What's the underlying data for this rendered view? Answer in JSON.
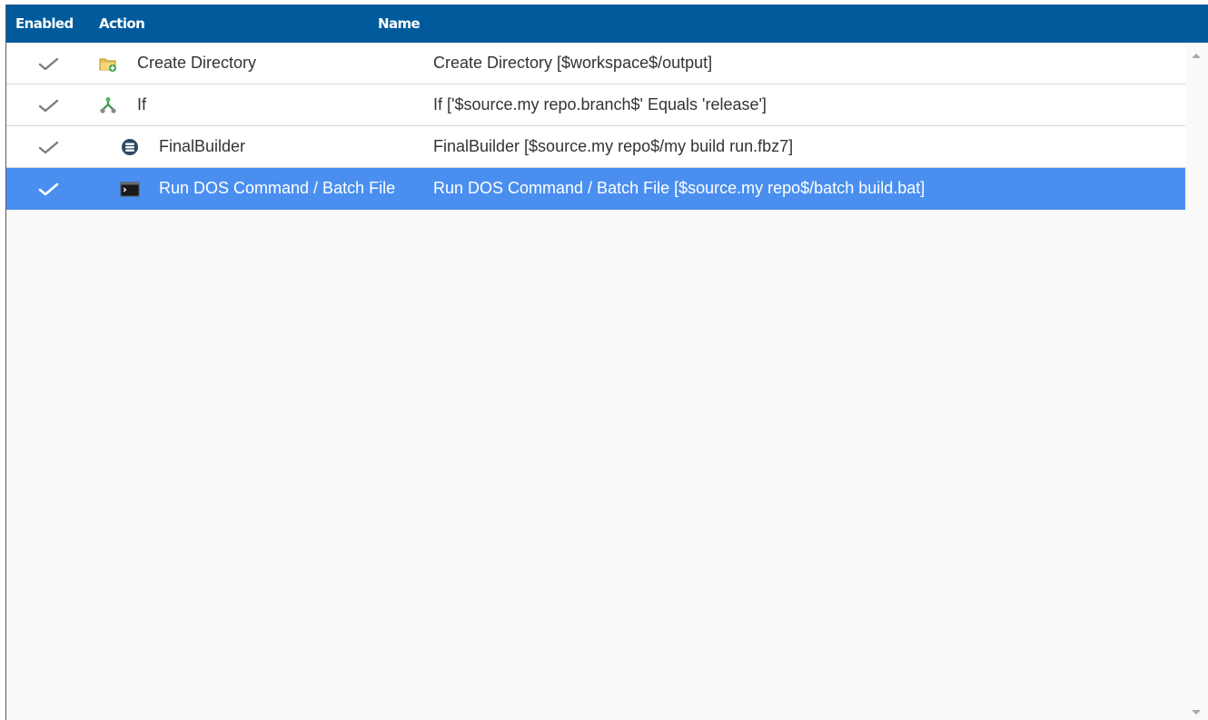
{
  "grid": {
    "columns": {
      "enabled": "Enabled",
      "action": "Action",
      "name": "Name"
    },
    "rows": [
      {
        "enabled": true,
        "icon": "folder-add-icon",
        "action": "Create Directory",
        "name": "Create Directory [$workspace$/output]",
        "selected": false
      },
      {
        "enabled": true,
        "icon": "branch-icon",
        "action": "If",
        "name": "If ['$source.my repo.branch$' Equals 'release']",
        "selected": false
      },
      {
        "enabled": true,
        "icon": "finalbuilder-icon",
        "action": "FinalBuilder",
        "name": "FinalBuilder [$source.my repo$/my build run.fbz7]",
        "selected": false
      },
      {
        "enabled": true,
        "icon": "console-icon",
        "action": "Run DOS Command / Batch File",
        "name": "Run DOS Command / Batch File [$source.my repo$/batch build.bat]",
        "selected": true
      }
    ]
  },
  "colors": {
    "header_bg": "#005a9b",
    "selection_bg": "#4a8ff0",
    "text": "#333333"
  }
}
